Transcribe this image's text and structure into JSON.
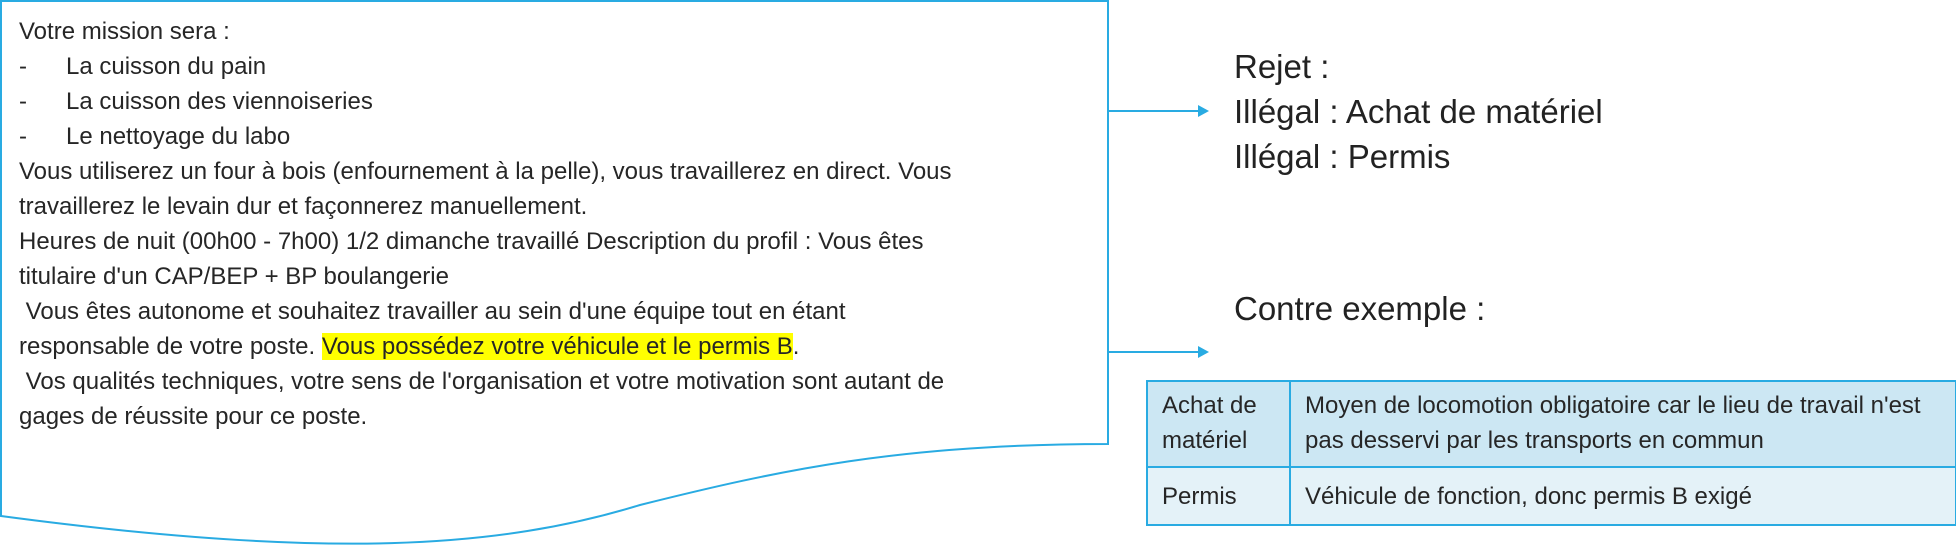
{
  "document": {
    "intro": "Votre mission sera :",
    "bullet_marker": "-",
    "bullets": [
      "La cuisson du pain",
      "La cuisson des viennoiseries",
      "Le nettoyage du labo"
    ],
    "line1": "Vous utiliserez un four à bois (enfournement à la pelle), vous travaillerez en direct. Vous",
    "line2": "travaillerez le levain dur et façonnerez manuellement.",
    "line3": "Heures de nuit (00h00 - 7h00) 1/2 dimanche travaillé Description du profil : Vous êtes",
    "line4": "titulaire d'un CAP/BEP + BP boulangerie",
    "line5": " Vous êtes autonome et souhaitez travailler au sein d'une équipe tout en étant",
    "line6_before": "responsable de votre poste. ",
    "line6_highlight": "Vous possédez votre véhicule et le permis B",
    "line6_after": ".",
    "line7": " Vos qualités techniques, votre sens de l'organisation et votre motivation sont autant de",
    "line8": "gages de réussite pour ce poste."
  },
  "rejection": {
    "title": "Rejet :",
    "items": [
      "Illégal : Achat de matériel",
      "Illégal : Permis"
    ]
  },
  "counter_example": {
    "title": "Contre exemple :",
    "rows": [
      {
        "label": "Achat de matériel",
        "text": "Moyen de locomotion obligatoire car le lieu de travail n'est pas desservi par les transports en commun"
      },
      {
        "label": "Permis",
        "text": "Véhicule de fonction, donc permis B exigé"
      }
    ]
  },
  "colors": {
    "accent": "#29abe2",
    "highlight": "#ffff00",
    "table_row_1": "#cce7f3",
    "table_row_2": "#e4f2f8"
  }
}
